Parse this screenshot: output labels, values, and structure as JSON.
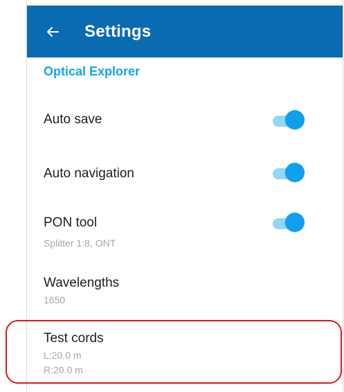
{
  "header": {
    "title": "Settings",
    "back_icon": "arrow-left-icon"
  },
  "colors": {
    "app_bar": "#0a6bb3",
    "section_title": "#12a6e6",
    "toggle_on": "#0ea0ed",
    "toggle_track": "#91d7f6",
    "highlight_border": "#d51b1b"
  },
  "section": {
    "title": "Optical Explorer"
  },
  "settings": [
    {
      "label": "Auto save",
      "toggle_on": true
    },
    {
      "label": "Auto navigation",
      "toggle_on": true
    },
    {
      "label": "PON tool",
      "subtitle": "Splitter 1:8, ONT",
      "toggle_on": true
    },
    {
      "label": "Wavelengths",
      "subtitle": "1650"
    },
    {
      "label": "Test cords",
      "subtitle_lines": [
        "L:20.0 m",
        "R:20.0 m"
      ]
    }
  ]
}
